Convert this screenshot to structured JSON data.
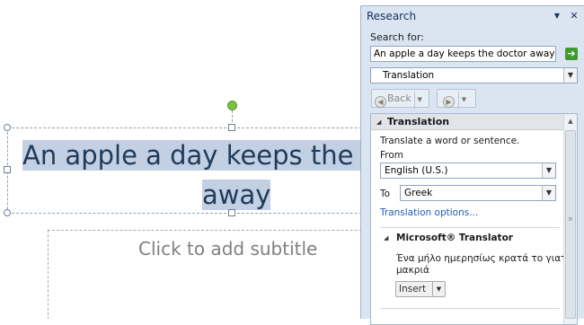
{
  "slide": {
    "title_line1": "An apple a day keeps the d",
    "title_line2": "away",
    "subtitle_placeholder": "Click to add subtitle"
  },
  "research_pane": {
    "title": "Research",
    "dropdown_glyph": "▼",
    "close_glyph": "✕",
    "search_label": "Search for:",
    "search_value": "An apple a day keeps the doctor away",
    "service_select": "Translation",
    "back_label": "Back",
    "section_title": "Translation",
    "instruction": "Translate a word or sentence.",
    "from_label": "From",
    "from_value": "English (U.S.)",
    "to_label": "To",
    "to_value": "Greek",
    "options_link": "Translation options...",
    "translator_title": "Microsoft® Translator",
    "translation_line1": "Ένα μήλο ημερησίως κρατά το γιατρό",
    "translation_line2": "μακριά",
    "insert_label": "Insert"
  },
  "colors": {
    "pane_bg": "#dbe5f2",
    "selection": "#c3cfe3",
    "title_text": "#1f3a5a",
    "link": "#1f5bb5",
    "go_button": "#3e9b2c",
    "rotation_handle": "#7ac142"
  },
  "icons": [
    "rotation-handle",
    "sizing-handle",
    "go-arrow-icon",
    "back-icon",
    "forward-icon",
    "collapse-triangle-icon",
    "scroll-up-icon",
    "dropdown-arrow-icon",
    "close-icon"
  ]
}
